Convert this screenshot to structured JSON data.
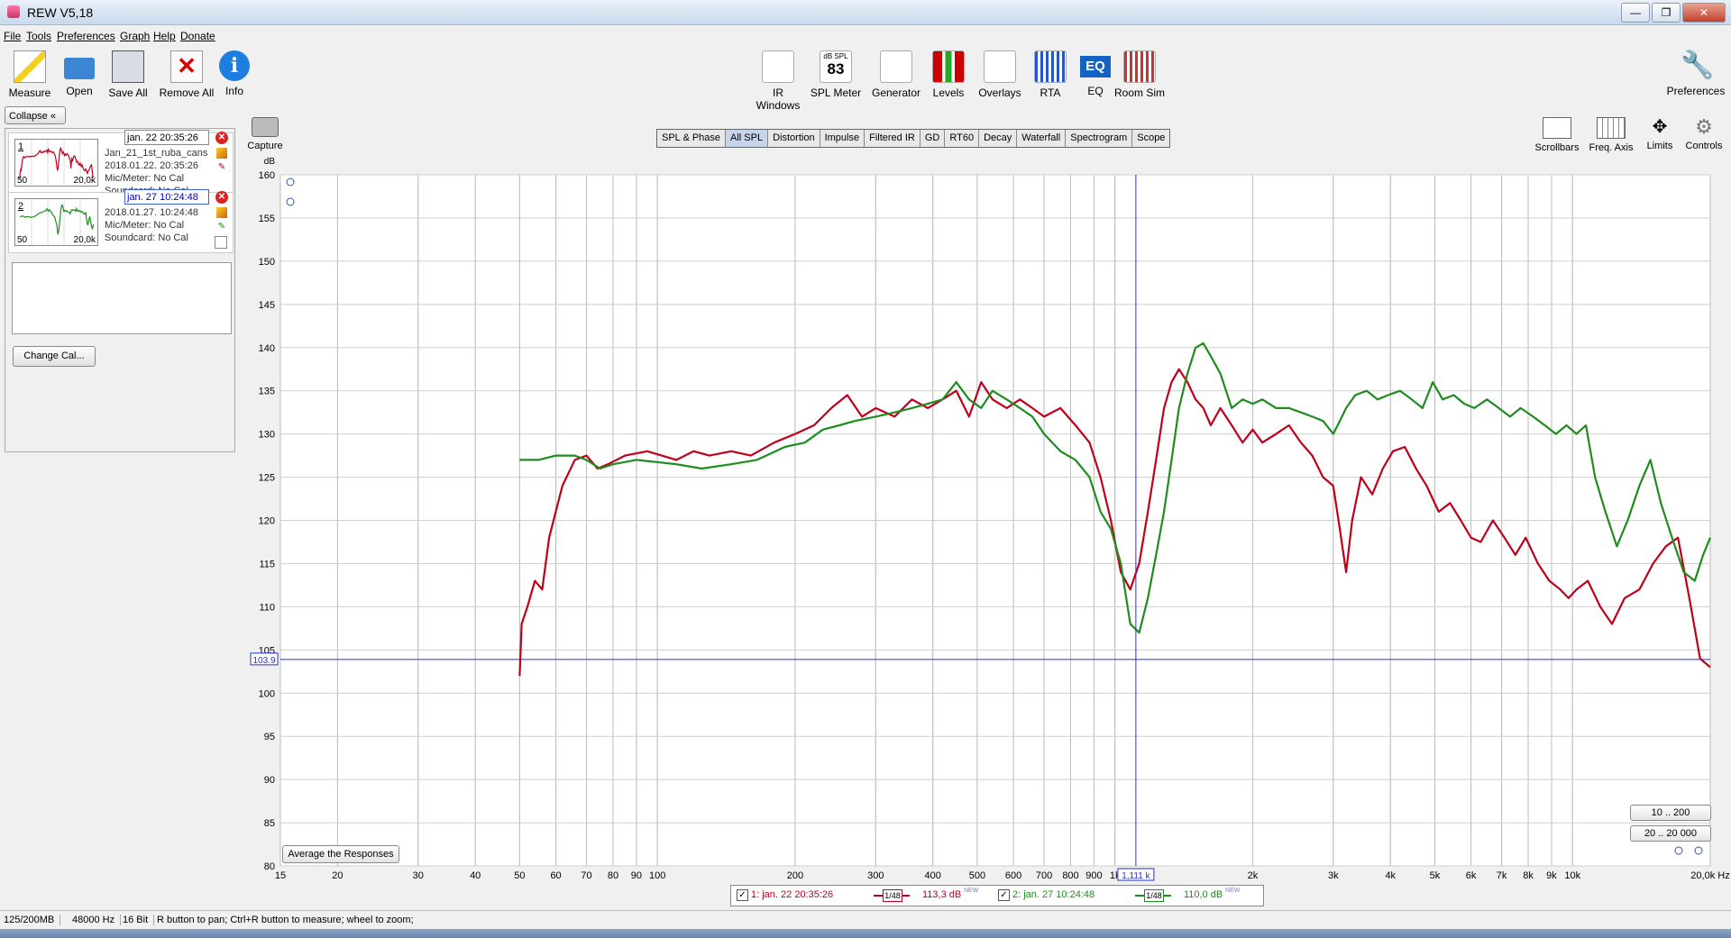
{
  "window": {
    "title": "REW V5,18",
    "minimize": "—",
    "restore": "❐",
    "close": "✕"
  },
  "menu": [
    "File",
    "Tools",
    "Preferences",
    "Graph",
    "Help",
    "Donate"
  ],
  "toolbar_left": [
    "Measure",
    "Open",
    "Save All",
    "Remove All",
    "Info"
  ],
  "toolbar_center": [
    "IR Windows",
    "SPL Meter",
    "Generator",
    "Levels",
    "Overlays",
    "RTA",
    "EQ",
    "Room Sim"
  ],
  "spl_meter_icon": {
    "caption": "dB SPL",
    "value": "83"
  },
  "eq_icon_text": "EQ",
  "toolbar_right": "Preferences",
  "collapse_label": "Collapse",
  "capture_label": "Capture",
  "measurements": [
    {
      "num": "1",
      "name": "jan. 22 20:35:26",
      "line1": "Jan_21_1st_ruba_cans",
      "line2": "2018.01.22. 20:35:26",
      "line3": "Mic/Meter: No Cal",
      "line4": "Soundcard: No Cal",
      "thumb_lo": "50",
      "thumb_hi": "20,0k",
      "color": "#c0001a"
    },
    {
      "num": "2",
      "name": "jan. 27 10:24:48",
      "line1": "2018.01.27. 10:24:48",
      "line2": "Mic/Meter: No Cal",
      "line3": "Soundcard: No Cal",
      "thumb_lo": "50",
      "thumb_hi": "20,0k",
      "color": "#1e8c1e"
    }
  ],
  "change_cal_label": "Change Cal...",
  "tabs": [
    "SPL & Phase",
    "All SPL",
    "Distortion",
    "Impulse",
    "Filtered IR",
    "GD",
    "RT60",
    "Decay",
    "Waterfall",
    "Spectrogram",
    "Scope"
  ],
  "selected_tab": "All SPL",
  "right_tools": [
    "Scrollbars",
    "Freq. Axis",
    "Limits",
    "Controls"
  ],
  "range_buttons": [
    "10 .. 200",
    "20 .. 20 000"
  ],
  "average_button": "Average the Responses",
  "legend": [
    {
      "label": "1: jan. 22 20:35:26",
      "smoothing": "1/48",
      "value": "113,3 dB",
      "tag": "NEW",
      "color": "#c0001a"
    },
    {
      "label": "2: jan. 27 10:24:48",
      "smoothing": "1/48",
      "value": "110,0 dB",
      "tag": "NEW",
      "color": "#1e8c1e"
    }
  ],
  "cursor": {
    "freq_label": "1,111 k",
    "db_label": "103.9",
    "freq": 1111,
    "db": 103.9
  },
  "status": [
    "125/200MB",
    "48000 Hz",
    "16 Bit",
    "R button to pan; Ctrl+R button to measure; wheel to zoom;"
  ],
  "chart_data": {
    "type": "line",
    "ylabel": "dB",
    "xunit": "Hz",
    "x_scale": "log",
    "xlim": [
      15,
      20000
    ],
    "ylim": [
      80,
      160
    ],
    "y_ticks": [
      80,
      85,
      90,
      95,
      100,
      105,
      110,
      115,
      120,
      125,
      130,
      135,
      140,
      145,
      150,
      155,
      160
    ],
    "x_ticks": [
      {
        "v": 15,
        "l": "15"
      },
      {
        "v": 20,
        "l": "20"
      },
      {
        "v": 30,
        "l": "30"
      },
      {
        "v": 40,
        "l": "40"
      },
      {
        "v": 50,
        "l": "50"
      },
      {
        "v": 60,
        "l": "60"
      },
      {
        "v": 70,
        "l": "70"
      },
      {
        "v": 80,
        "l": "80"
      },
      {
        "v": 90,
        "l": "90"
      },
      {
        "v": 100,
        "l": "100"
      },
      {
        "v": 200,
        "l": "200"
      },
      {
        "v": 300,
        "l": "300"
      },
      {
        "v": 400,
        "l": "400"
      },
      {
        "v": 500,
        "l": "500"
      },
      {
        "v": 600,
        "l": "600"
      },
      {
        "v": 700,
        "l": "700"
      },
      {
        "v": 800,
        "l": "800"
      },
      {
        "v": 900,
        "l": "900"
      },
      {
        "v": 1000,
        "l": "1k"
      },
      {
        "v": 2000,
        "l": "2k"
      },
      {
        "v": 3000,
        "l": "3k"
      },
      {
        "v": 4000,
        "l": "4k"
      },
      {
        "v": 5000,
        "l": "5k"
      },
      {
        "v": 6000,
        "l": "6k"
      },
      {
        "v": 7000,
        "l": "7k"
      },
      {
        "v": 8000,
        "l": "8k"
      },
      {
        "v": 9000,
        "l": "9k"
      },
      {
        "v": 10000,
        "l": "10k"
      },
      {
        "v": 20000,
        "l": "20,0k Hz"
      }
    ],
    "grid": true,
    "series": [
      {
        "name": "1: jan. 22 20:35:26",
        "color": "#c0001a",
        "points": [
          [
            50,
            102
          ],
          [
            50.5,
            108
          ],
          [
            52,
            110
          ],
          [
            54,
            113
          ],
          [
            56,
            112
          ],
          [
            58,
            118
          ],
          [
            62,
            124
          ],
          [
            66,
            127
          ],
          [
            70,
            127.5
          ],
          [
            74,
            126
          ],
          [
            78,
            126.5
          ],
          [
            85,
            127.5
          ],
          [
            95,
            128
          ],
          [
            110,
            127
          ],
          [
            120,
            128
          ],
          [
            130,
            127.5
          ],
          [
            145,
            128
          ],
          [
            160,
            127.5
          ],
          [
            180,
            129
          ],
          [
            200,
            130
          ],
          [
            220,
            131
          ],
          [
            240,
            133
          ],
          [
            260,
            134.5
          ],
          [
            280,
            132
          ],
          [
            300,
            133
          ],
          [
            330,
            132
          ],
          [
            360,
            134
          ],
          [
            390,
            133
          ],
          [
            420,
            134
          ],
          [
            450,
            135
          ],
          [
            480,
            132
          ],
          [
            510,
            136
          ],
          [
            540,
            134
          ],
          [
            580,
            133
          ],
          [
            620,
            134
          ],
          [
            660,
            133
          ],
          [
            700,
            132
          ],
          [
            760,
            133
          ],
          [
            820,
            131
          ],
          [
            880,
            129
          ],
          [
            930,
            125
          ],
          [
            980,
            120
          ],
          [
            1030,
            114
          ],
          [
            1080,
            112
          ],
          [
            1130,
            115
          ],
          [
            1180,
            121
          ],
          [
            1230,
            127
          ],
          [
            1280,
            133
          ],
          [
            1330,
            136
          ],
          [
            1380,
            137.5
          ],
          [
            1440,
            136
          ],
          [
            1500,
            134
          ],
          [
            1560,
            133
          ],
          [
            1620,
            131
          ],
          [
            1700,
            133
          ],
          [
            1800,
            131
          ],
          [
            1900,
            129
          ],
          [
            2000,
            130.5
          ],
          [
            2100,
            129
          ],
          [
            2250,
            130
          ],
          [
            2400,
            131
          ],
          [
            2550,
            129
          ],
          [
            2700,
            127.5
          ],
          [
            2850,
            125
          ],
          [
            3000,
            124
          ],
          [
            3100,
            119
          ],
          [
            3200,
            114
          ],
          [
            3300,
            120
          ],
          [
            3450,
            125
          ],
          [
            3650,
            123
          ],
          [
            3850,
            126
          ],
          [
            4050,
            128
          ],
          [
            4300,
            128.5
          ],
          [
            4550,
            126
          ],
          [
            4800,
            124
          ],
          [
            5100,
            121
          ],
          [
            5400,
            122
          ],
          [
            5700,
            120
          ],
          [
            6000,
            118
          ],
          [
            6300,
            117.5
          ],
          [
            6700,
            120
          ],
          [
            7100,
            118
          ],
          [
            7500,
            116
          ],
          [
            7900,
            118
          ],
          [
            8400,
            115
          ],
          [
            8900,
            113
          ],
          [
            9400,
            112
          ],
          [
            9800,
            111
          ],
          [
            10200,
            112
          ],
          [
            10800,
            113
          ],
          [
            11500,
            110
          ],
          [
            12200,
            108
          ],
          [
            13000,
            111
          ],
          [
            14000,
            112
          ],
          [
            15000,
            115
          ],
          [
            16000,
            117
          ],
          [
            17000,
            118
          ],
          [
            18000,
            111
          ],
          [
            19000,
            104
          ],
          [
            20000,
            103
          ]
        ]
      },
      {
        "name": "2: jan. 27 10:24:48",
        "color": "#1e8c1e",
        "points": [
          [
            50,
            127
          ],
          [
            55,
            127
          ],
          [
            60,
            127.5
          ],
          [
            66,
            127.5
          ],
          [
            70,
            127
          ],
          [
            75,
            126
          ],
          [
            80,
            126.5
          ],
          [
            90,
            127
          ],
          [
            110,
            126.5
          ],
          [
            125,
            126
          ],
          [
            145,
            126.5
          ],
          [
            165,
            127
          ],
          [
            190,
            128.5
          ],
          [
            210,
            129
          ],
          [
            230,
            130.5
          ],
          [
            250,
            131
          ],
          [
            270,
            131.5
          ],
          [
            300,
            132
          ],
          [
            330,
            132.5
          ],
          [
            360,
            133
          ],
          [
            390,
            133.5
          ],
          [
            420,
            134
          ],
          [
            450,
            136
          ],
          [
            480,
            134
          ],
          [
            510,
            133
          ],
          [
            540,
            135
          ],
          [
            580,
            134
          ],
          [
            620,
            133
          ],
          [
            660,
            132
          ],
          [
            700,
            130
          ],
          [
            760,
            128
          ],
          [
            820,
            127
          ],
          [
            880,
            125
          ],
          [
            930,
            121
          ],
          [
            980,
            119
          ],
          [
            1030,
            115
          ],
          [
            1080,
            108
          ],
          [
            1130,
            107
          ],
          [
            1180,
            111
          ],
          [
            1230,
            116
          ],
          [
            1280,
            121
          ],
          [
            1330,
            127
          ],
          [
            1380,
            133
          ],
          [
            1440,
            137
          ],
          [
            1500,
            140
          ],
          [
            1560,
            140.5
          ],
          [
            1620,
            139
          ],
          [
            1700,
            137
          ],
          [
            1800,
            133
          ],
          [
            1900,
            134
          ],
          [
            2000,
            133.5
          ],
          [
            2100,
            134
          ],
          [
            2250,
            133
          ],
          [
            2400,
            133
          ],
          [
            2550,
            132.5
          ],
          [
            2700,
            132
          ],
          [
            2850,
            131.5
          ],
          [
            3000,
            130
          ],
          [
            3100,
            131.5
          ],
          [
            3200,
            133
          ],
          [
            3350,
            134.5
          ],
          [
            3550,
            135
          ],
          [
            3750,
            134
          ],
          [
            3950,
            134.5
          ],
          [
            4200,
            135
          ],
          [
            4450,
            134
          ],
          [
            4700,
            133
          ],
          [
            4950,
            136
          ],
          [
            5200,
            134
          ],
          [
            5500,
            134.5
          ],
          [
            5800,
            133.5
          ],
          [
            6100,
            133
          ],
          [
            6500,
            134
          ],
          [
            6900,
            133
          ],
          [
            7300,
            132
          ],
          [
            7700,
            133
          ],
          [
            8200,
            132
          ],
          [
            8700,
            131
          ],
          [
            9200,
            130
          ],
          [
            9700,
            131
          ],
          [
            10200,
            130
          ],
          [
            10700,
            131
          ],
          [
            11200,
            125
          ],
          [
            11800,
            121
          ],
          [
            12500,
            117
          ],
          [
            13200,
            120
          ],
          [
            14000,
            124
          ],
          [
            14800,
            127
          ],
          [
            15600,
            122
          ],
          [
            16500,
            118
          ],
          [
            17500,
            114
          ],
          [
            18500,
            113
          ],
          [
            19300,
            116
          ],
          [
            20000,
            118
          ]
        ]
      }
    ]
  }
}
